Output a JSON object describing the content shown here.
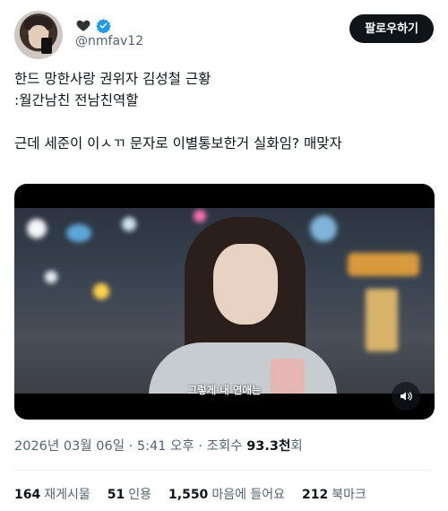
{
  "header": {
    "display_name_icons": [
      "black-heart-icon",
      "verified-badge-icon"
    ],
    "handle": "@nmfav12",
    "follow_label": "팔로우하기"
  },
  "tweet": {
    "text": "한드 망한사랑 권위자 김성철 근황\n:월간남친 전남친역할\n\n근데 세준이 이ㅅㄲ 문자로 이별통보한거 실화임? 매맞자"
  },
  "media": {
    "subtitle": "그렇게 내 연애는",
    "controls": {
      "volume_icon": "speaker-icon"
    }
  },
  "meta": {
    "date": "2026년 03월 06일",
    "separator": "·",
    "time": "5:41 오후",
    "views_label": "조회수",
    "views_value": "93.3천",
    "views_suffix": "회"
  },
  "stats": [
    {
      "value": "164",
      "label": "재게시물"
    },
    {
      "value": "51",
      "label": "인용"
    },
    {
      "value": "1,550",
      "label": "마음에 들어요"
    },
    {
      "value": "212",
      "label": "북마크"
    }
  ],
  "colors": {
    "text_primary": "#0f1419",
    "text_secondary": "#536471",
    "verified_blue": "#1d9bf0",
    "follow_button_bg": "#0f1419"
  }
}
